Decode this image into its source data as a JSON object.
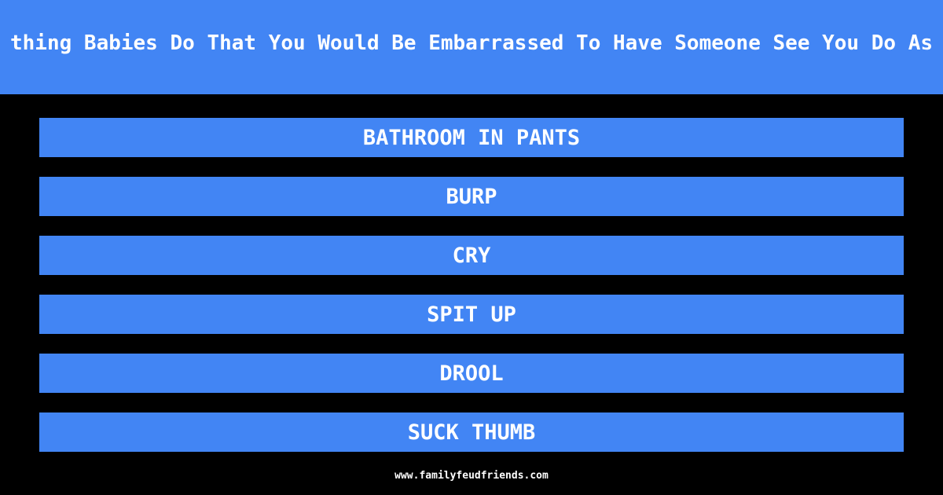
{
  "header": {
    "title": "thing Babies Do That You Would Be Embarrassed To Have Someone See You Do As"
  },
  "answers": [
    {
      "label": "BATHROOM IN PANTS"
    },
    {
      "label": "BURP"
    },
    {
      "label": "CRY"
    },
    {
      "label": "SPIT UP"
    },
    {
      "label": "DROOL"
    },
    {
      "label": "SUCK THUMB"
    }
  ],
  "footer": {
    "site": "www.familyfeudfriends.com"
  },
  "colors": {
    "accent": "#4285F4",
    "background": "#000000",
    "text": "#FFFFFF"
  }
}
